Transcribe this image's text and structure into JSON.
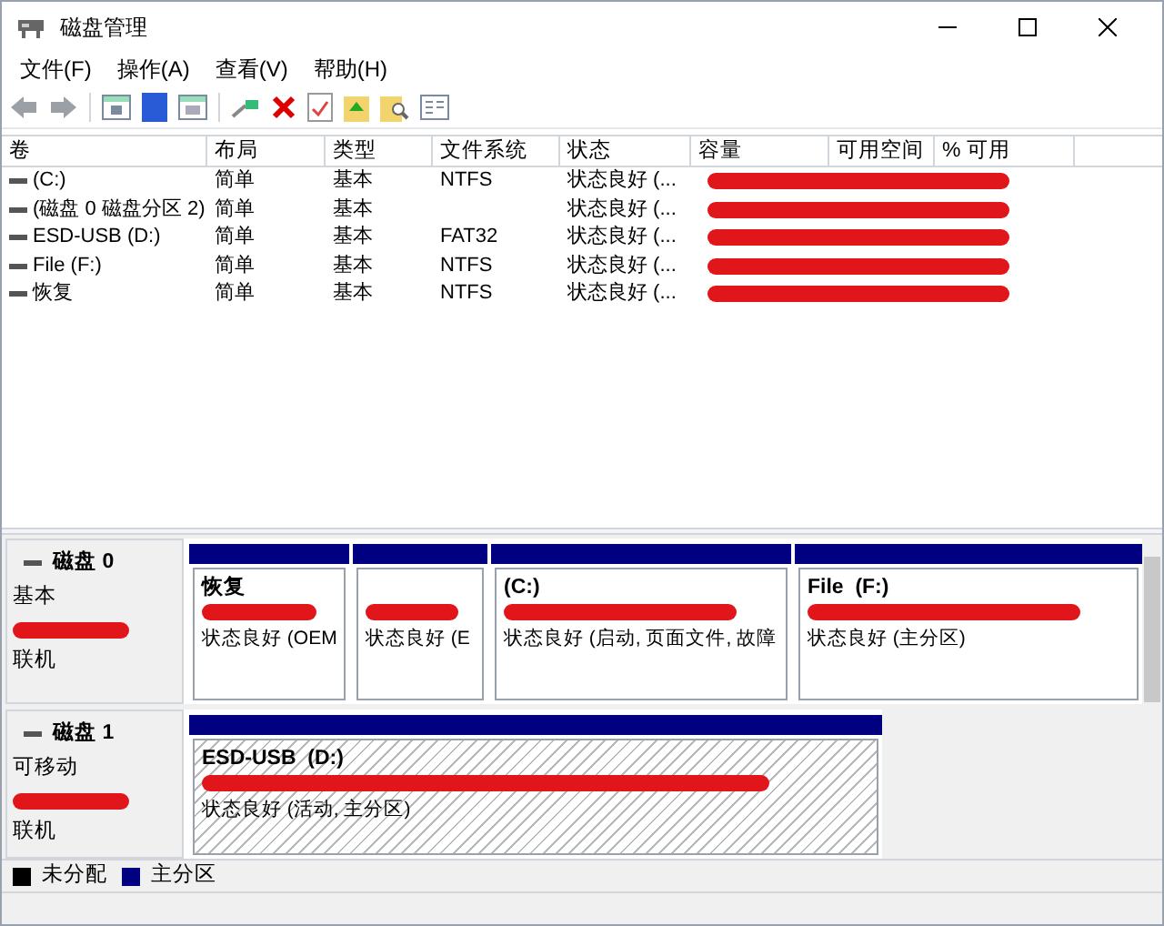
{
  "window": {
    "title": "磁盘管理"
  },
  "menu": [
    "文件(F)",
    "操作(A)",
    "查看(V)",
    "帮助(H)"
  ],
  "volumes": {
    "columns": [
      "卷",
      "布局",
      "类型",
      "文件系统",
      "状态",
      "容量",
      "可用空间",
      "% 可用"
    ],
    "rows": [
      {
        "volume": "(C:)",
        "layout": "简单",
        "type": "基本",
        "file_system": "NTFS",
        "status": "状态良好 (...",
        "redacted": true
      },
      {
        "volume": "(磁盘 0 磁盘分区 2)",
        "layout": "简单",
        "type": "基本",
        "status": "状态良好 (...",
        "redacted": true
      },
      {
        "volume": "ESD-USB (D:)",
        "layout": "简单",
        "type": "基本",
        "file_system": "FAT32",
        "status": "状态良好 (...",
        "redacted": true
      },
      {
        "volume": "File (F:)",
        "layout": "简单",
        "type": "基本",
        "file_system": "NTFS",
        "status": "状态良好 (...",
        "redacted": true
      },
      {
        "volume": "恢复",
        "layout": "简单",
        "type": "基本",
        "file_system": "NTFS",
        "status": "状态良好 (...",
        "redacted": true
      }
    ]
  },
  "disks": [
    {
      "name": "磁盘 0",
      "type": "基本",
      "state": "联机",
      "redacted": true,
      "partitions": [
        {
          "label": "恢复",
          "status": "状态良好 (OEM",
          "redacted": true,
          "selected": false
        },
        {
          "status": "状态良好 (E",
          "redacted": true,
          "selected": false
        },
        {
          "label": "(C:)",
          "status": "状态良好 (启动, 页面文件, 故障",
          "redacted": true,
          "selected": false
        },
        {
          "label": "File  (F:)",
          "status": "状态良好 (主分区)",
          "redacted": true,
          "selected": false
        }
      ]
    },
    {
      "name": "磁盘 1",
      "type": "可移动",
      "state": "联机",
      "redacted": true,
      "partitions": [
        {
          "label": "ESD-USB  (D:)",
          "status": "状态良好 (活动, 主分区)",
          "redacted": true,
          "selected": true
        }
      ]
    }
  ],
  "legend": [
    {
      "label": "未分配",
      "color": "#000000"
    },
    {
      "label": "主分区",
      "color": "#000080"
    }
  ]
}
